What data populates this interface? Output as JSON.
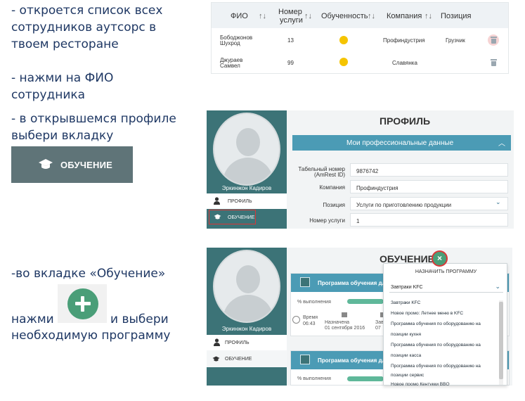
{
  "instructions": {
    "step1": [
      "- откроется список всех",
      "сотрудников аутсорс в",
      "твоем ресторане"
    ],
    "step2": [
      "- нажми на ФИО",
      "сотрудника"
    ],
    "step3": [
      "- в открывшемся профиле",
      "выбери вкладку"
    ],
    "step4": [
      "-во вкладке «Обучение»",
      "нажми",
      "и выбери",
      "необходимую программу"
    ]
  },
  "edu_button": {
    "label": "ОБУЧЕНИЕ",
    "icon": "graduation-cap-icon"
  },
  "plus_button": {
    "icon": "plus-icon"
  },
  "table": {
    "headers": {
      "fio": "ФИО",
      "number": [
        "Номер",
        "услуги"
      ],
      "education": "Обученность",
      "company": "Компания",
      "position": "Позиция"
    },
    "sort_glyph": "↑↓",
    "rows": [
      {
        "name": [
          "Бободжонов",
          "Шухрод"
        ],
        "number": "13",
        "company": "Профиндустрия",
        "position": "Грузчик"
      },
      {
        "name": [
          "Джураев",
          "Самвел"
        ],
        "number": "99",
        "company": "Славянка",
        "position": ""
      }
    ]
  },
  "profile": {
    "title": "ПРОФИЛЬ",
    "employee_name": "Эркинжон Кадиров",
    "menu": {
      "profile": "ПРОФИЛЬ",
      "education": "ОБУЧЕНИЕ"
    },
    "section": "Мои профессиональные данные",
    "fields": {
      "tab_number_label": [
        "Табельный номер",
        "(AmRest ID)"
      ],
      "tab_number": "9876742",
      "company_label": "Компания",
      "company": "Профиндустрия",
      "position_label": "Позиция",
      "position": "Услуги по приготовлению продукции",
      "service_label": "Номер услуги",
      "service": "1"
    }
  },
  "education": {
    "title": "ОБУЧЕНИЕ",
    "employee_name": "Эркинжон Кадиров",
    "menu": {
      "profile": "ПРОФИЛЬ",
      "education": "ОБУЧЕНИЕ"
    },
    "card_title": "Программа обучения для",
    "percent_label": "% выполнения",
    "time_label": [
      "Время",
      "06:43"
    ],
    "assigned_label": [
      "Назначена",
      "01 сентября 2016"
    ],
    "deadline_label": [
      "Зав",
      "07"
    ],
    "close_glyph": "×",
    "dropdown": {
      "heading": "НАЗНАЧИТЬ ПРОГРАММУ",
      "selected": "Завтраки KFC",
      "chevron": "⌄",
      "items": [
        "Завтраки KFC",
        "Новое промо: Летнее меню в KFC",
        "Программа обучения по оборудованию на",
        "позиции кухня",
        "Программа обучения по оборудованию на",
        "позиции касса",
        "Программа обучения по оборудованию на",
        "позиции сервис",
        "Новое промо Кентукки ВВQ"
      ]
    }
  }
}
